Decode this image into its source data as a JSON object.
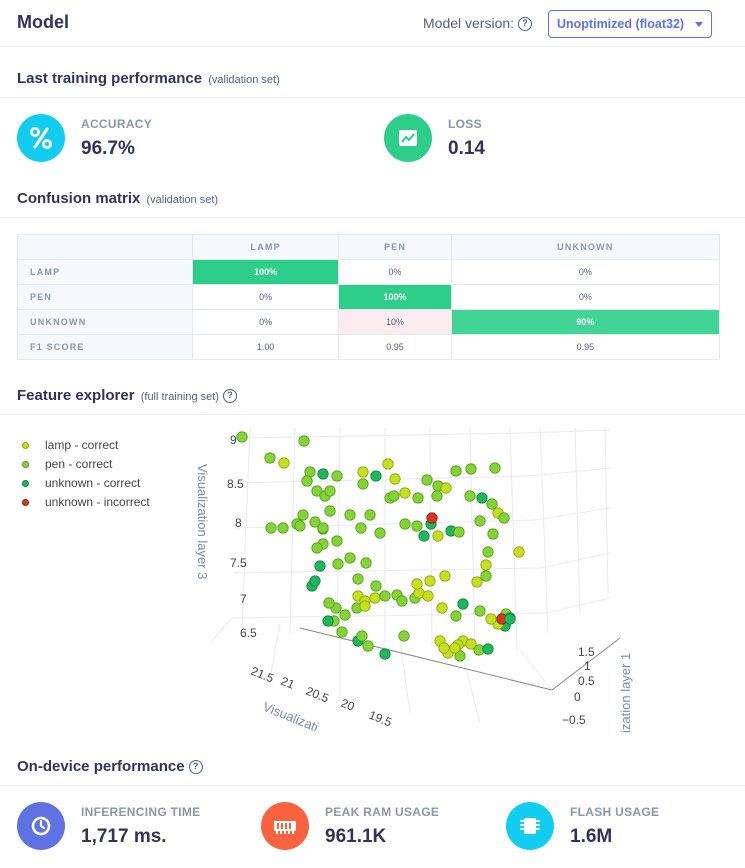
{
  "header": {
    "title": "Model",
    "version_label": "Model version:",
    "version_value": "Unoptimized (float32)"
  },
  "training": {
    "title": "Last training performance",
    "subtitle": "(validation set)",
    "accuracy": {
      "label": "ACCURACY",
      "value": "96.7%",
      "icon": "percent-icon",
      "color": "#11cdef"
    },
    "loss": {
      "label": "LOSS",
      "value": "0.14",
      "icon": "chart-line-icon",
      "color": "#2dce89"
    }
  },
  "confusion": {
    "title": "Confusion matrix",
    "subtitle": "(validation set)",
    "columns": [
      "LAMP",
      "PEN",
      "UNKNOWN"
    ],
    "rows": [
      {
        "label": "LAMP",
        "cells": [
          "100%",
          "0%",
          "0%"
        ]
      },
      {
        "label": "PEN",
        "cells": [
          "0%",
          "100%",
          "0%"
        ]
      },
      {
        "label": "UNKNOWN",
        "cells": [
          "0%",
          "10%",
          "90%"
        ]
      },
      {
        "label": "F1 SCORE",
        "cells": [
          "1.00",
          "0.95",
          "0.95"
        ]
      }
    ]
  },
  "explorer": {
    "title": "Feature explorer",
    "subtitle": "(full training set)",
    "legend": [
      {
        "label": "lamp - correct",
        "color": "#c6e01b"
      },
      {
        "label": "pen - correct",
        "color": "#84d436"
      },
      {
        "label": "unknown - correct",
        "color": "#1eb85c"
      },
      {
        "label": "unknown - incorrect",
        "color": "#d9361e"
      }
    ],
    "axis_layer3_label": "Visualization layer 3",
    "axis_layer2_label": "Visualizati",
    "axis_layer1_label": "ization layer 1",
    "z_ticks": [
      "9",
      "8.5",
      "8",
      "7.5",
      "7",
      "6.5"
    ],
    "y_ticks": [
      "21.5",
      "21",
      "20.5",
      "20",
      "19.5"
    ],
    "x_ticks": [
      "1.5",
      "1",
      "0.5",
      "0",
      "−0.5"
    ]
  },
  "device": {
    "title": "On-device performance",
    "inferencing": {
      "label": "INFERENCING TIME",
      "value": "1,717 ms.",
      "icon": "clock-icon",
      "color": "#5e72e4"
    },
    "ram": {
      "label": "PEAK RAM USAGE",
      "value": "961.1K",
      "icon": "memory-icon",
      "color": "#fb6340"
    },
    "flash": {
      "label": "FLASH USAGE",
      "value": "1.6M",
      "icon": "chip-icon",
      "color": "#11cdef"
    }
  }
}
